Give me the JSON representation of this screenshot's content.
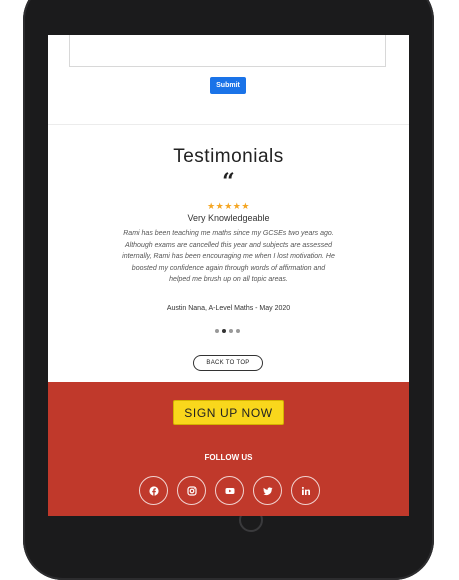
{
  "form": {
    "submit_label": "Submit"
  },
  "testimonials": {
    "title": "Testimonials",
    "quote_glyph": "“",
    "stars": "★★★★★",
    "rating": 5,
    "headline": "Very Knowledgeable",
    "body": "Rami has been teaching me maths since my GCSEs two years ago. Although exams are cancelled this year and subjects are assessed internally, Rami has been encouraging me when I lost motivation. He boosted my confidence again through words of affirmation and helped me brush up on all topic areas.",
    "author": "Austin Nana, A-Level Maths - May 2020",
    "carousel_dots": 4,
    "active_dot": 2
  },
  "back_to_top_label": "BACK TO TOP",
  "footer": {
    "signup_label": "SIGN UP NOW",
    "follow_label": "FOLLOW US",
    "social_icons": [
      "facebook-icon",
      "instagram-icon",
      "youtube-icon",
      "twitter-icon",
      "linkedin-icon"
    ]
  },
  "colors": {
    "footer_bg": "#c0392b",
    "signup_bg": "#f9d71c",
    "submit_bg": "#1a73e8",
    "star": "#f5a623"
  }
}
